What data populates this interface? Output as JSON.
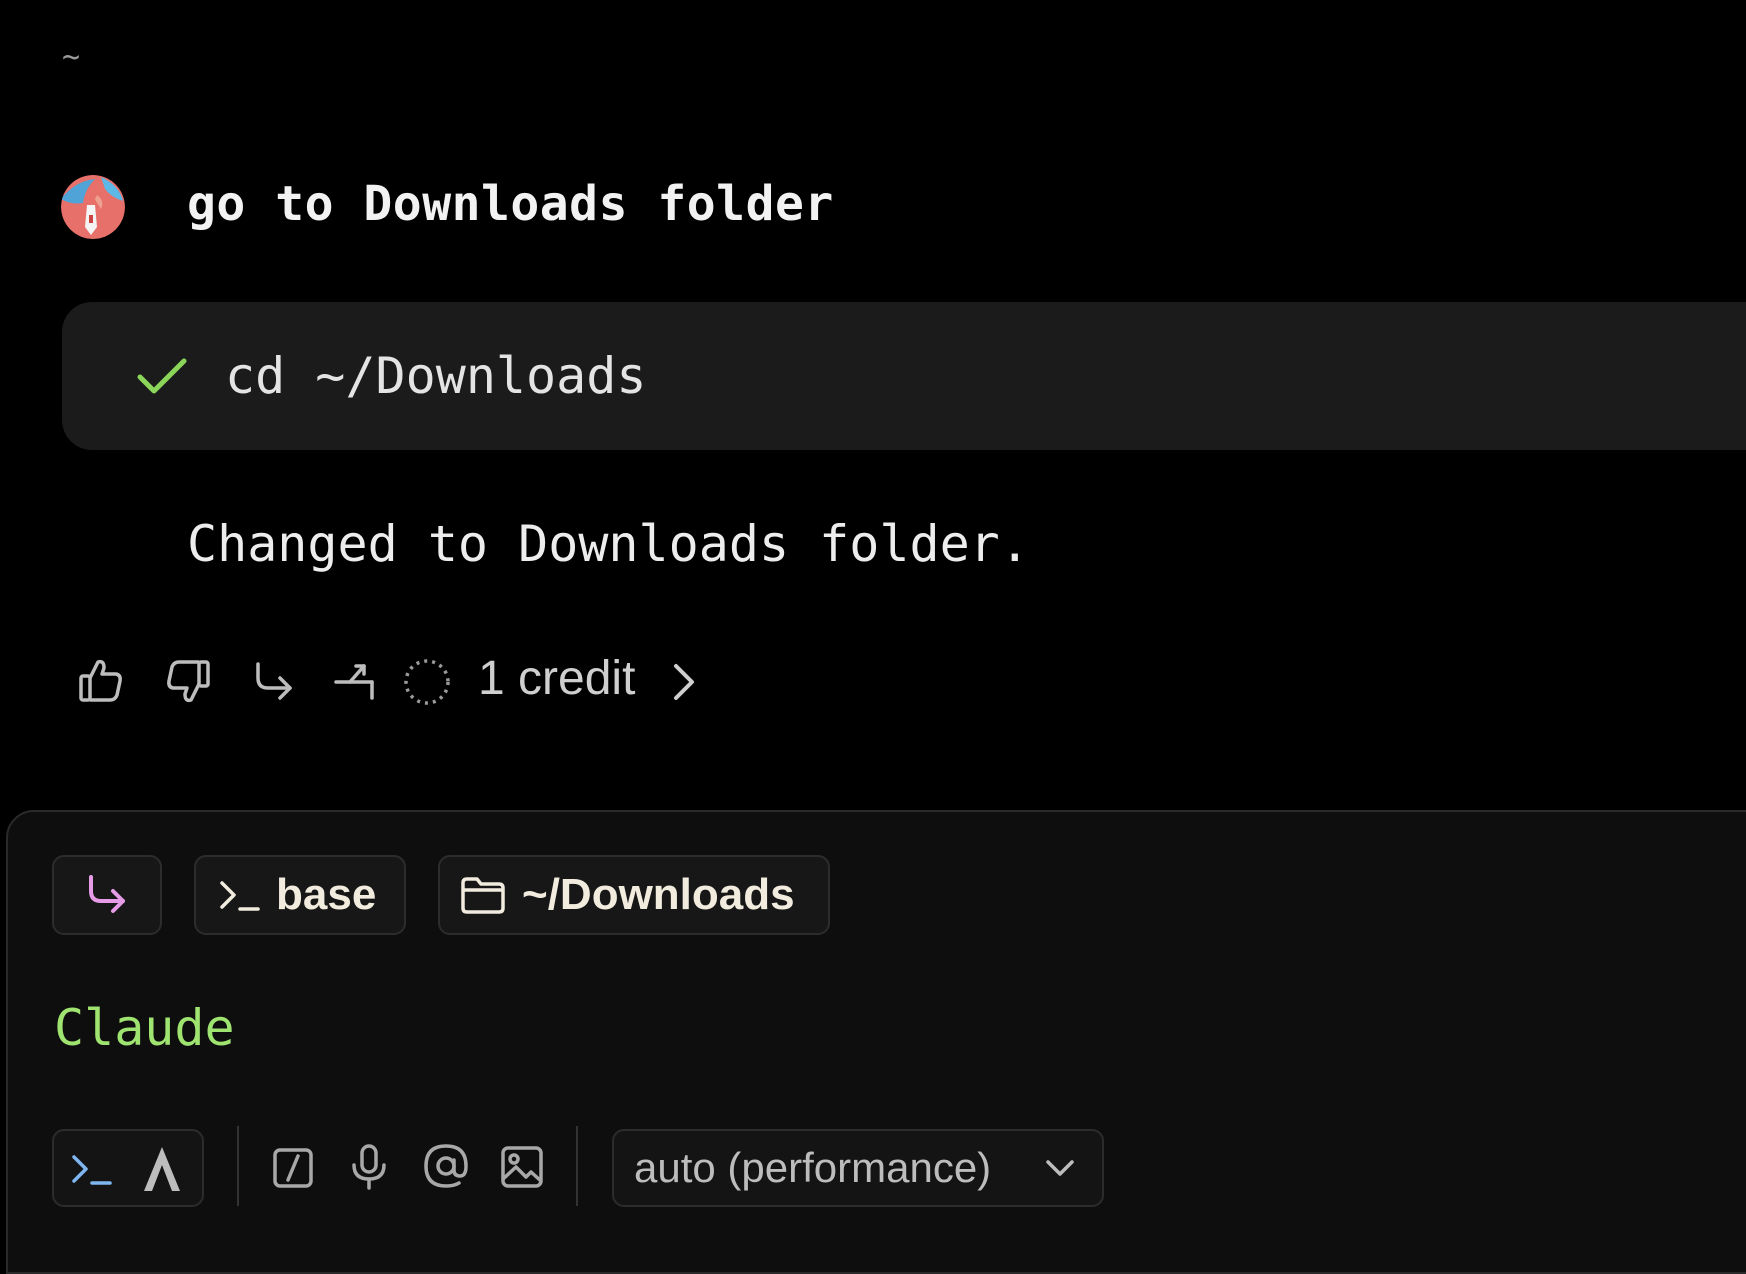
{
  "header": {
    "cwd_symbol": "~"
  },
  "conversation": {
    "user_prompt": "go to Downloads folder",
    "command": {
      "text": "cd ~/Downloads",
      "status": "success"
    },
    "response": "Changed to Downloads folder.",
    "actions": {
      "icons": [
        "thumbs-up-icon",
        "thumbs-down-icon",
        "reply-icon",
        "fork-icon",
        "spinner-icon",
        "chevron-right-icon"
      ],
      "credit_label": "1 credit"
    }
  },
  "input": {
    "chips": {
      "reply_icon": "reply-icon",
      "env_label": "base",
      "dir_label": "~/Downloads"
    },
    "current_text": "Claude",
    "toolbar": {
      "icons": [
        "terminal-icon",
        "agent-icon",
        "slash-command-icon",
        "microphone-icon",
        "mention-icon",
        "image-icon"
      ],
      "model_label": "auto (performance)"
    }
  },
  "colors": {
    "background": "#000000",
    "panel": "#0e0e0e",
    "success": "#8bd65a",
    "input_text": "#9fe370",
    "accent_pink": "#e59be6",
    "accent_blue": "#7fb6f0"
  }
}
